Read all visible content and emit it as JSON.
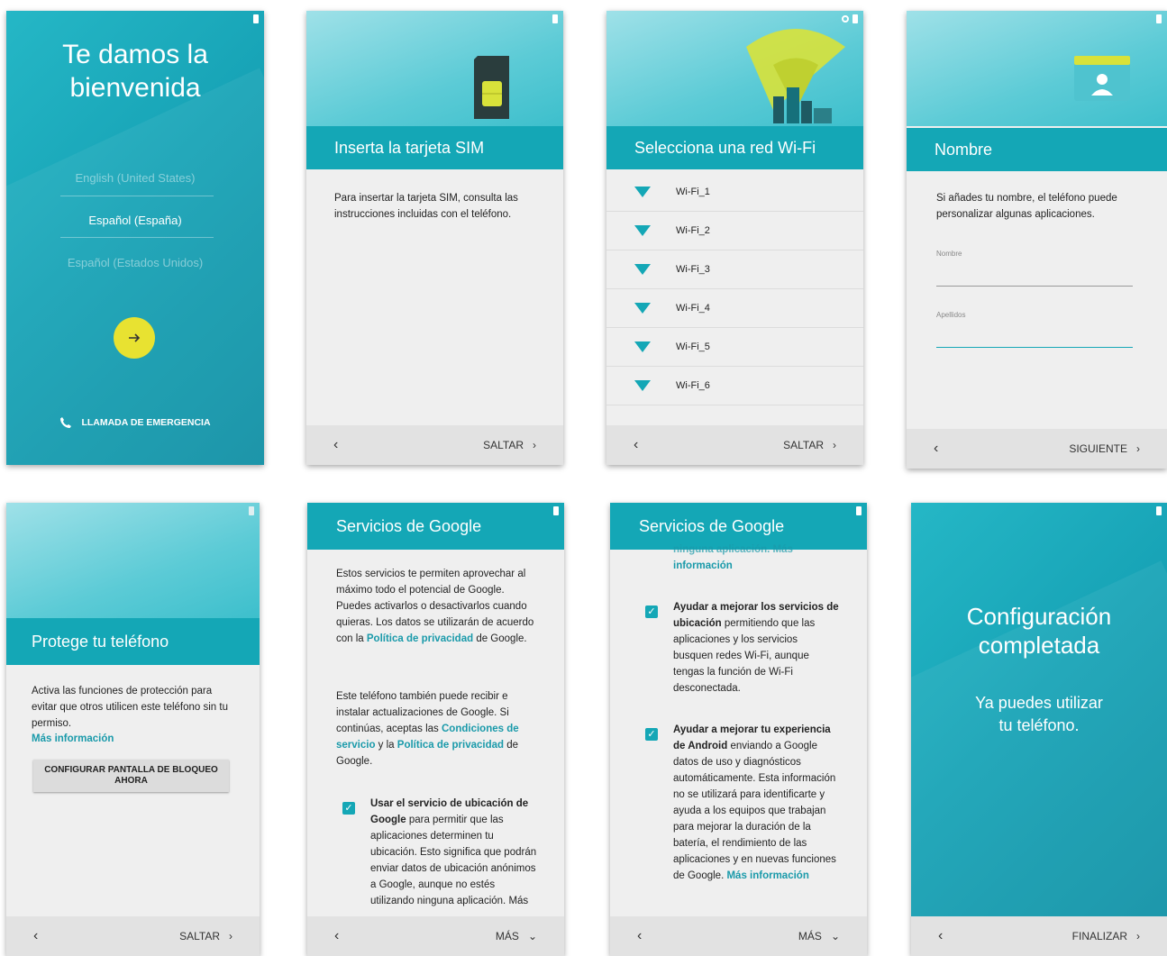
{
  "colors": {
    "teal": "#14a7b6",
    "yellow_button": "#e8e231",
    "footer_bg": "#e2e2e2",
    "link": "#1a9aaa"
  },
  "welcome": {
    "title_line1": "Te damos la",
    "title_line2": "bienvenida",
    "languages": [
      "English (United States)",
      "Español (España)",
      "Español (Estados Unidos)"
    ],
    "selected_language": "Español (España)",
    "next_icon": "arrow-right-icon",
    "emergency_label": "LLAMADA DE EMERGENCIA"
  },
  "sim": {
    "title": "Inserta la tarjeta SIM",
    "body": "Para insertar la tarjeta SIM, consulta las instrucciones incluidas con el teléfono.",
    "back": "‹",
    "skip": "SALTAR"
  },
  "wifi": {
    "title": "Selecciona una red Wi-Fi",
    "networks": [
      "Wi-Fi_1",
      "Wi-Fi_2",
      "Wi-Fi_3",
      "Wi-Fi_4",
      "Wi-Fi_5",
      "Wi-Fi_6"
    ],
    "back": "‹",
    "skip": "SALTAR"
  },
  "name": {
    "title": "Nombre",
    "body": "Si añades tu nombre, el teléfono puede personalizar algunas aplicaciones.",
    "first_name_label": "Nombre",
    "last_name_label": "Apellidos",
    "back": "‹",
    "next": "SIGUIENTE"
  },
  "protect": {
    "title": "Protege tu teléfono",
    "body": "Activa las funciones de protección para evitar que otros utilicen este teléfono sin tu permiso.",
    "more_info": "Más información",
    "lock_button_line1": "CONFIGURAR PANTALLA DE BLOQUEO",
    "lock_button_line2": "AHORA",
    "back": "‹",
    "skip": "SALTAR"
  },
  "google1": {
    "title": "Servicios de Google",
    "p1_a": "Estos servicios te permiten aprovechar al máximo todo el potencial de Google. Puedes activarlos o desactivarlos cuando quieras. Los datos se utilizarán de acuerdo con la ",
    "p1_link": "Política de privacidad",
    "p1_b": " de Google.",
    "p2_a": "Este teléfono también puede recibir e instalar actualizaciones de Google. Si continúas, aceptas las ",
    "p2_link1": "Condiciones de servicio",
    "p2_mid": " y la ",
    "p2_link2": "Política de privacidad",
    "p2_b": " de Google.",
    "opt_bold": "Usar el servicio de ubicación de Google",
    "opt_text": " para permitir que las aplicaciones determinen tu ubicación. Esto significa que podrán enviar datos de ubicación anónimos a Google, aunque no estés utilizando ninguna aplicación. Más",
    "back": "‹",
    "more": "MÁS"
  },
  "google2": {
    "title": "Servicios de Google",
    "top_cut": "ninguna aplicación. Más",
    "top_link": "información",
    "opt1_bold": "Ayudar a mejorar los servicios de ubicación",
    "opt1_text": " permitiendo que las aplicaciones y los servicios busquen redes Wi-Fi, aunque tengas la función de Wi-Fi desconectada.",
    "opt2_bold": "Ayudar a mejorar tu experiencia de Android",
    "opt2_text": " enviando a Google datos de uso y diagnósticos automáticamente. Esta información no se utilizará para identificarte y ayuda a los equipos que trabajan para mejorar la duración de la batería, el rendimiento de las aplicaciones y en nuevas funciones de Google. ",
    "opt2_link": "Más información",
    "back": "‹",
    "more": "MÁS"
  },
  "done": {
    "title_line1": "Configuración",
    "title_line2": "completada",
    "sub_line1": "Ya puedes utilizar",
    "sub_line2": "tu teléfono.",
    "back": "‹",
    "finish": "FINALIZAR"
  }
}
